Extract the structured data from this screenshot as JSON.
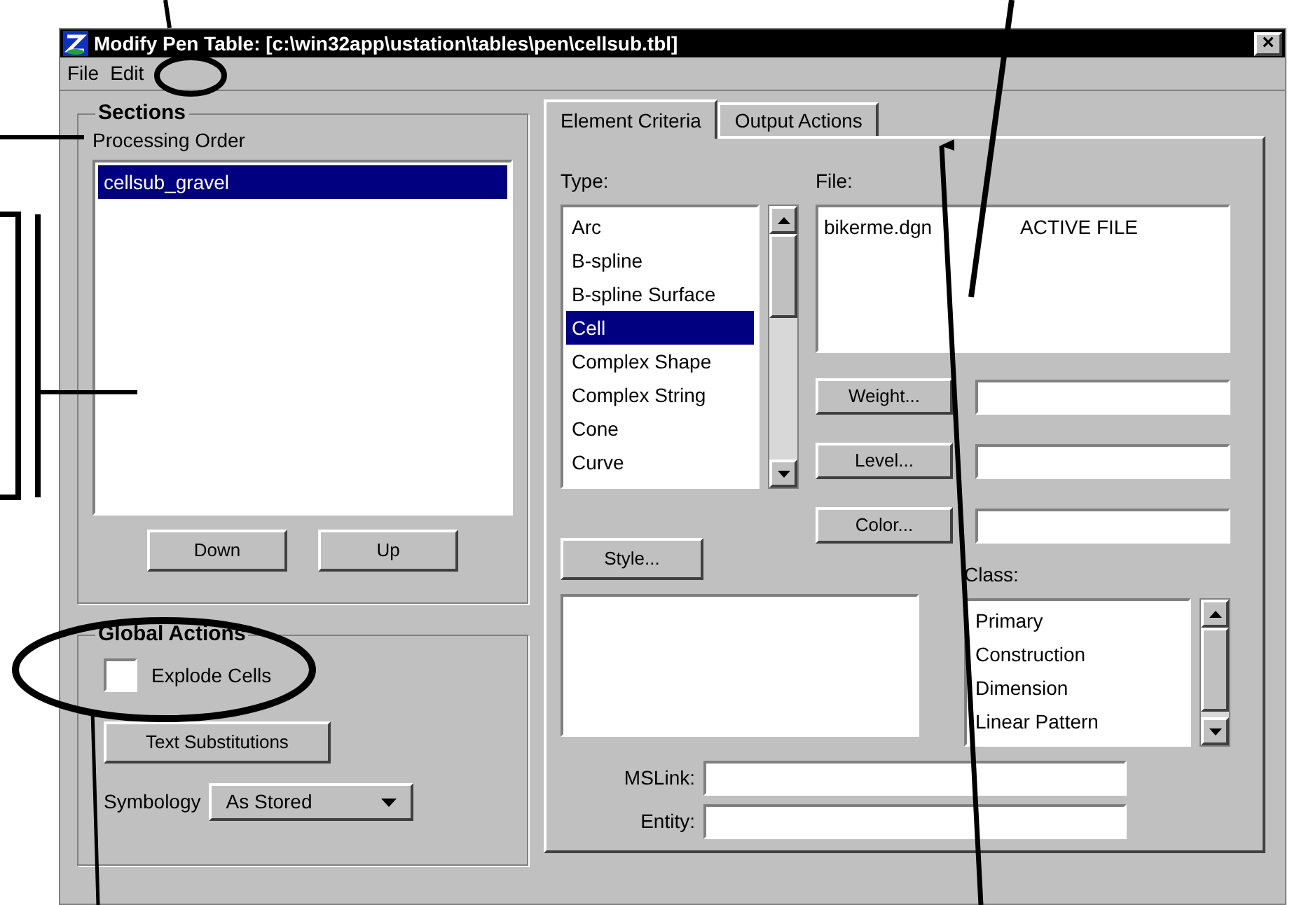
{
  "window": {
    "title": "Modify Pen Table: [c:\\win32app\\ustation\\tables\\pen\\cellsub.tbl]",
    "close": "×"
  },
  "menu": [
    {
      "label": "File"
    },
    {
      "label": "Edit"
    }
  ],
  "sections": {
    "title": "Sections",
    "list_label": "Processing Order",
    "items": [
      {
        "label": "cellsub_gravel",
        "selected": true
      }
    ],
    "buttons": [
      "Down",
      "Up"
    ]
  },
  "global_actions": {
    "title": "Global Actions",
    "checkbox": {
      "label": "Explode Cells",
      "checked": false
    },
    "button": "Text Substitutions",
    "symbology": {
      "label": "Symbology",
      "value": "As Stored"
    }
  },
  "tabs": [
    {
      "label": "Element Criteria",
      "selected": true
    },
    {
      "label": "Output Actions",
      "selected": false
    }
  ],
  "criteria": {
    "type_label": "Type:",
    "type_items": [
      {
        "label": "Arc",
        "selected": false
      },
      {
        "label": "B-spline",
        "selected": false
      },
      {
        "label": "B-spline Surface",
        "selected": false
      },
      {
        "label": "Cell",
        "selected": true
      },
      {
        "label": "Complex Shape",
        "selected": false
      },
      {
        "label": "Complex String",
        "selected": false
      },
      {
        "label": "Cone",
        "selected": false
      },
      {
        "label": "Curve",
        "selected": false
      }
    ],
    "file_label": "File:",
    "file_rows": [
      {
        "name": "bikerme.dgn",
        "status": "ACTIVE FILE"
      }
    ],
    "attribute_buttons": [
      "Weight...",
      "Level...",
      "Color..."
    ],
    "style_button": "Style...",
    "class_label": "Class:",
    "class_items": [
      {
        "label": "Primary",
        "selected": false
      },
      {
        "label": "Construction",
        "selected": false
      },
      {
        "label": "Dimension",
        "selected": false
      },
      {
        "label": "Linear Pattern",
        "selected": false
      }
    ],
    "mslink_label": "MSLink:",
    "entity_label": "Entity:"
  }
}
